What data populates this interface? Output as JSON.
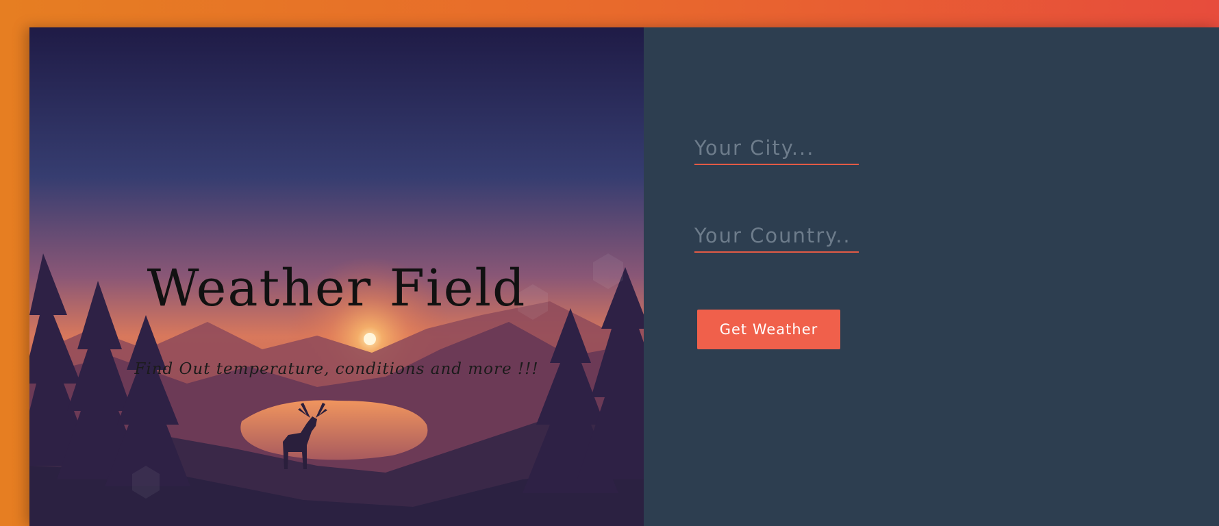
{
  "hero": {
    "title": "Weather Field",
    "subtitle": "Find Out temperature, conditions and more !!!",
    "image": "sunset-lake-deer-illustration"
  },
  "form": {
    "city_placeholder": "Your City...",
    "country_placeholder": "Your Country..",
    "submit_label": "Get Weather"
  },
  "colors": {
    "background_gradient_start": "#e67e22",
    "background_gradient_end": "#e74c3c",
    "panel": "#2d3e50",
    "accent": "#f0604b",
    "field_underline": "#e35a45"
  }
}
